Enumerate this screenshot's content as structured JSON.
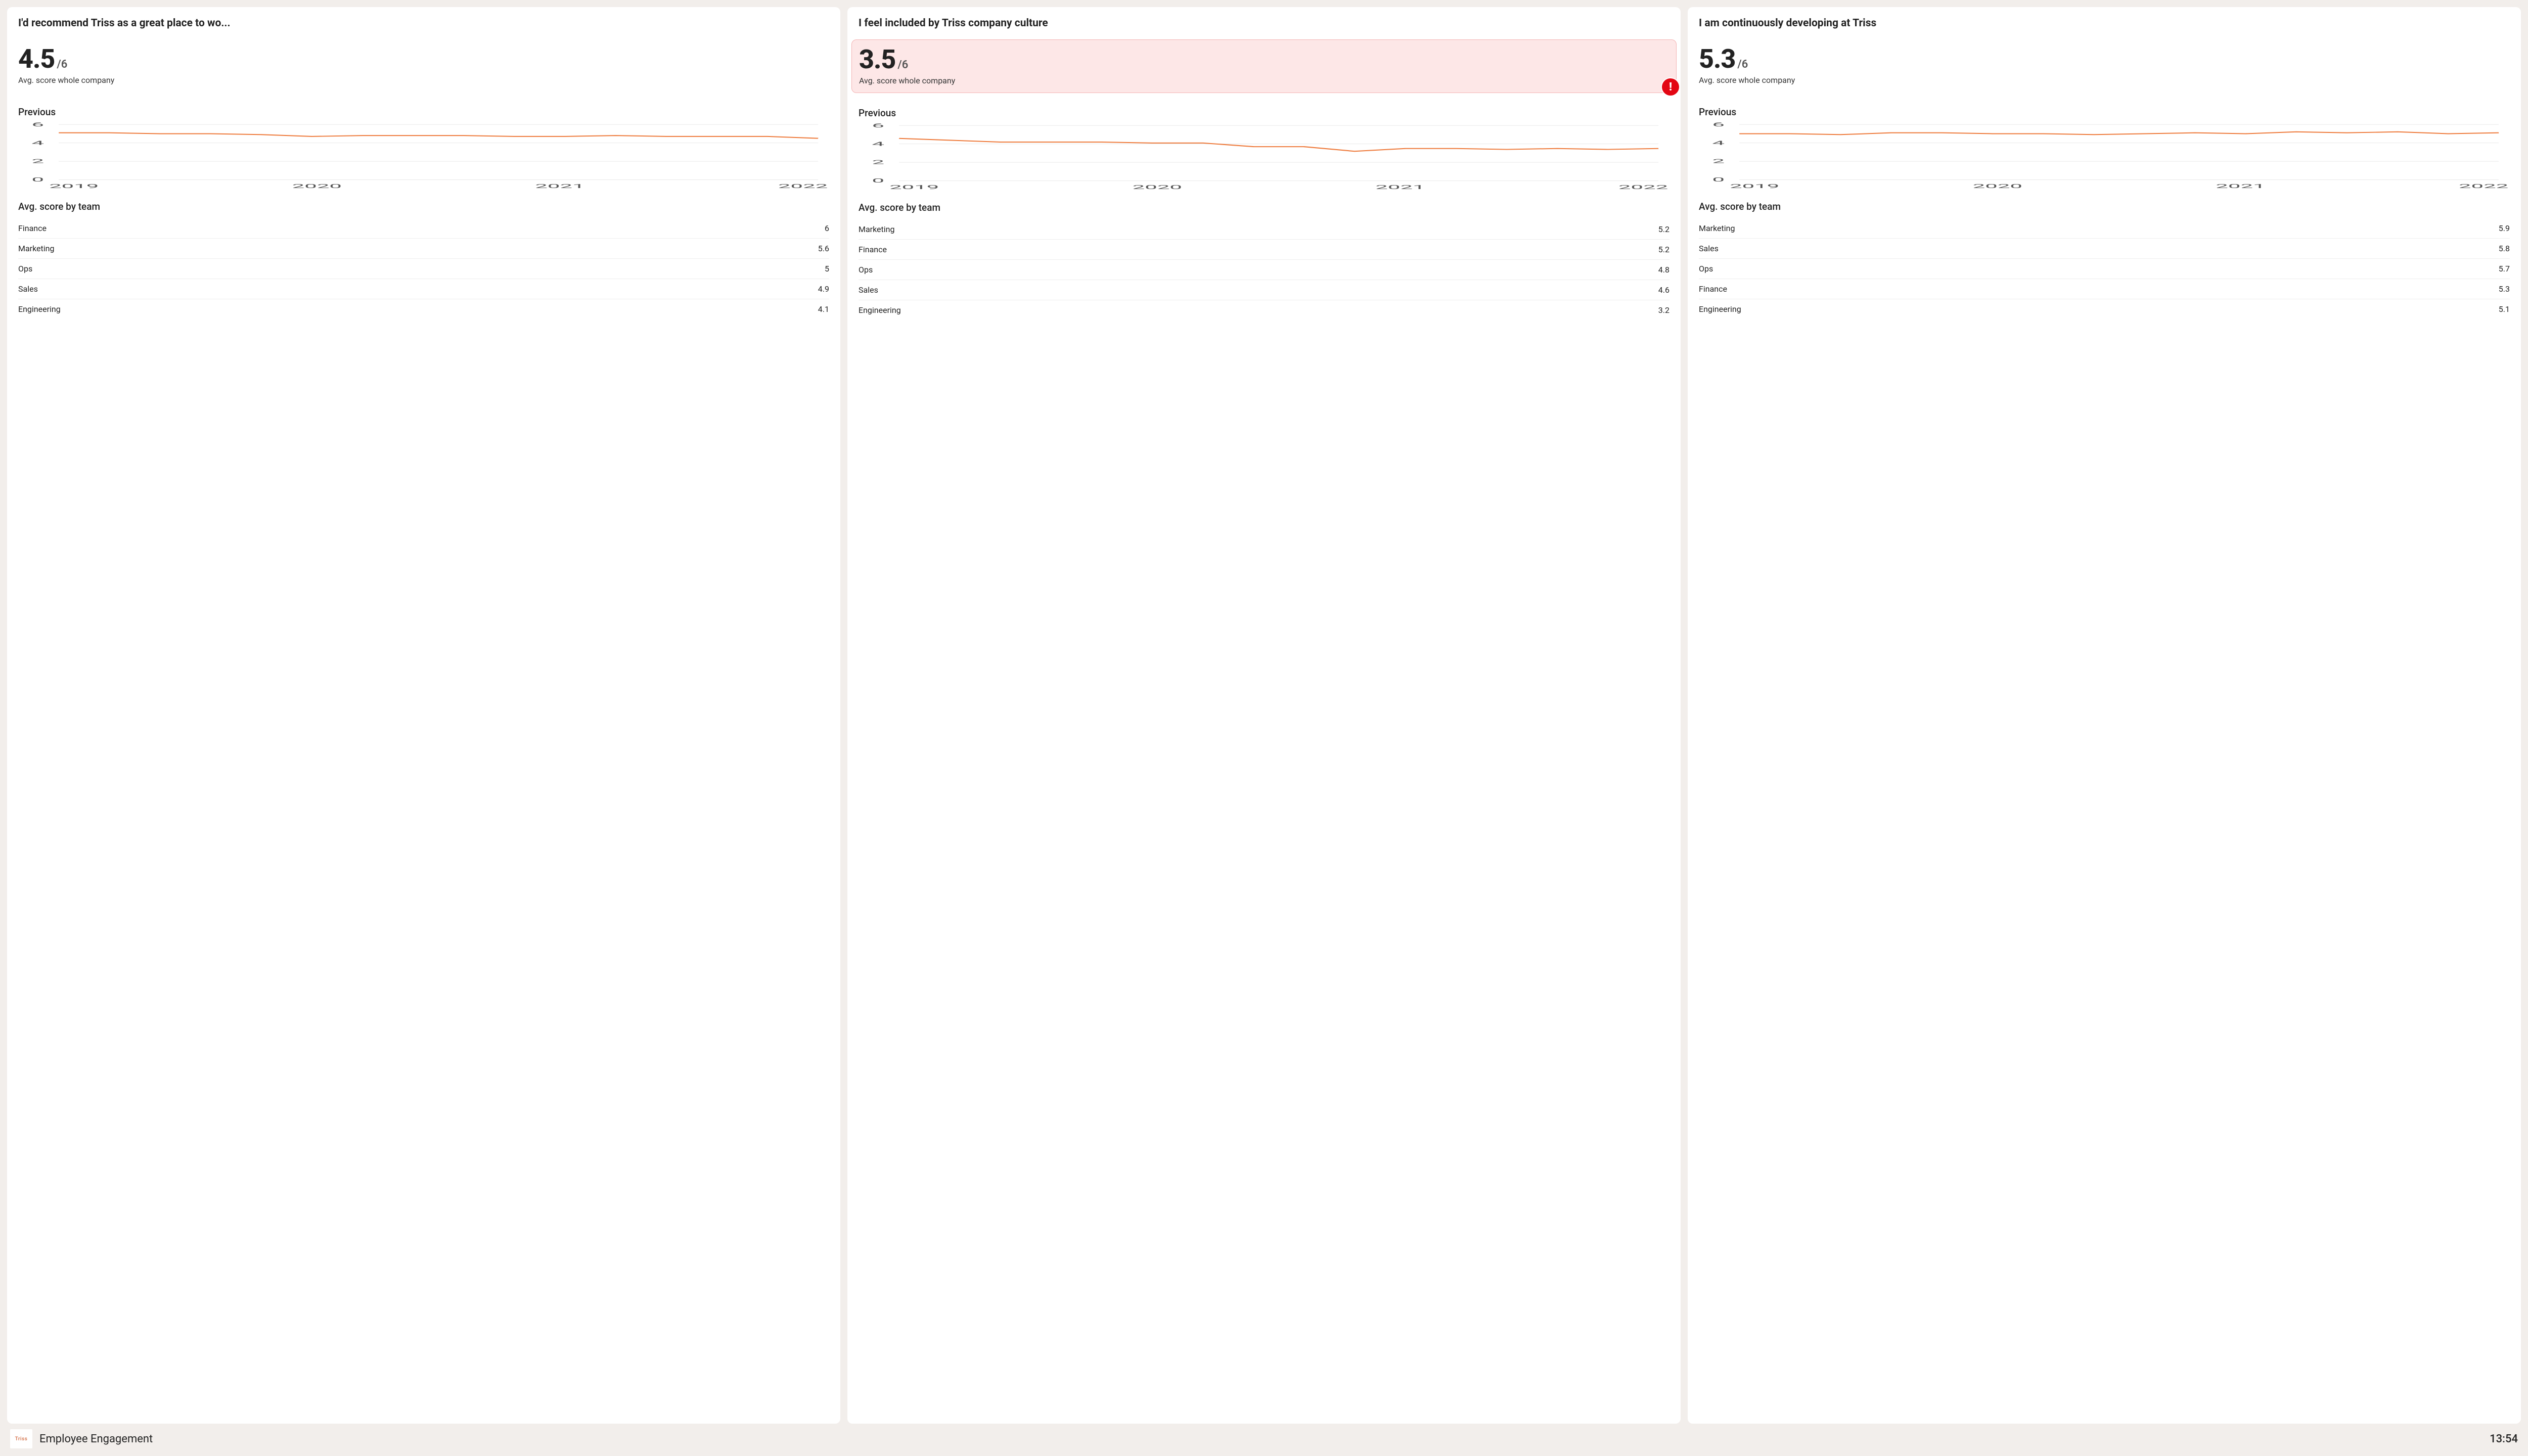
{
  "footer": {
    "logo_text": "Triss",
    "title": "Employee Engagement",
    "time": "13:54"
  },
  "common": {
    "score_max_label": "/6",
    "score_sub": "Avg. score whole company",
    "previous_label": "Previous",
    "by_team_label": "Avg. score by team"
  },
  "cards": [
    {
      "title": "I'd recommend Triss as a great place to wo...",
      "score": "4.5",
      "alert": false,
      "teams": [
        {
          "name": "Finance",
          "value": "6"
        },
        {
          "name": "Marketing",
          "value": "5.6"
        },
        {
          "name": "Ops",
          "value": "5"
        },
        {
          "name": "Sales",
          "value": "4.9"
        },
        {
          "name": "Engineering",
          "value": "4.1"
        }
      ]
    },
    {
      "title": "I feel included by Triss company culture",
      "score": "3.5",
      "alert": true,
      "teams": [
        {
          "name": "Marketing",
          "value": "5.2"
        },
        {
          "name": "Finance",
          "value": "5.2"
        },
        {
          "name": "Ops",
          "value": "4.8"
        },
        {
          "name": "Sales",
          "value": "4.6"
        },
        {
          "name": "Engineering",
          "value": "3.2"
        }
      ]
    },
    {
      "title": "I am continuously developing at Triss",
      "score": "5.3",
      "alert": false,
      "teams": [
        {
          "name": "Marketing",
          "value": "5.9"
        },
        {
          "name": "Sales",
          "value": "5.8"
        },
        {
          "name": "Ops",
          "value": "5.7"
        },
        {
          "name": "Finance",
          "value": "5.3"
        },
        {
          "name": "Engineering",
          "value": "5.1"
        }
      ]
    }
  ],
  "chart_data": [
    {
      "type": "line",
      "title": "Previous",
      "xlabel": "",
      "ylabel": "",
      "ylim": [
        0,
        6
      ],
      "y_ticks": [
        0,
        2,
        4,
        6
      ],
      "x_ticks": [
        "2019",
        "2020",
        "2021",
        "2022"
      ],
      "series": [
        {
          "name": "score",
          "values": [
            5.1,
            5.1,
            5.0,
            5.0,
            4.9,
            4.7,
            4.8,
            4.8,
            4.8,
            4.7,
            4.7,
            4.8,
            4.7,
            4.7,
            4.7,
            4.5
          ]
        }
      ]
    },
    {
      "type": "line",
      "title": "Previous",
      "xlabel": "",
      "ylabel": "",
      "ylim": [
        0,
        6
      ],
      "y_ticks": [
        0,
        2,
        4,
        6
      ],
      "x_ticks": [
        "2019",
        "2020",
        "2021",
        "2022"
      ],
      "series": [
        {
          "name": "score",
          "values": [
            4.6,
            4.4,
            4.2,
            4.2,
            4.2,
            4.1,
            4.1,
            3.7,
            3.7,
            3.2,
            3.5,
            3.5,
            3.4,
            3.5,
            3.4,
            3.5
          ]
        }
      ]
    },
    {
      "type": "line",
      "title": "Previous",
      "xlabel": "",
      "ylabel": "",
      "ylim": [
        0,
        6
      ],
      "y_ticks": [
        0,
        2,
        4,
        6
      ],
      "x_ticks": [
        "2019",
        "2020",
        "2021",
        "2022"
      ],
      "series": [
        {
          "name": "score",
          "values": [
            5.0,
            5.0,
            4.9,
            5.1,
            5.1,
            5.0,
            5.0,
            4.9,
            5.0,
            5.1,
            5.0,
            5.2,
            5.1,
            5.2,
            5.0,
            5.1
          ]
        }
      ]
    }
  ]
}
